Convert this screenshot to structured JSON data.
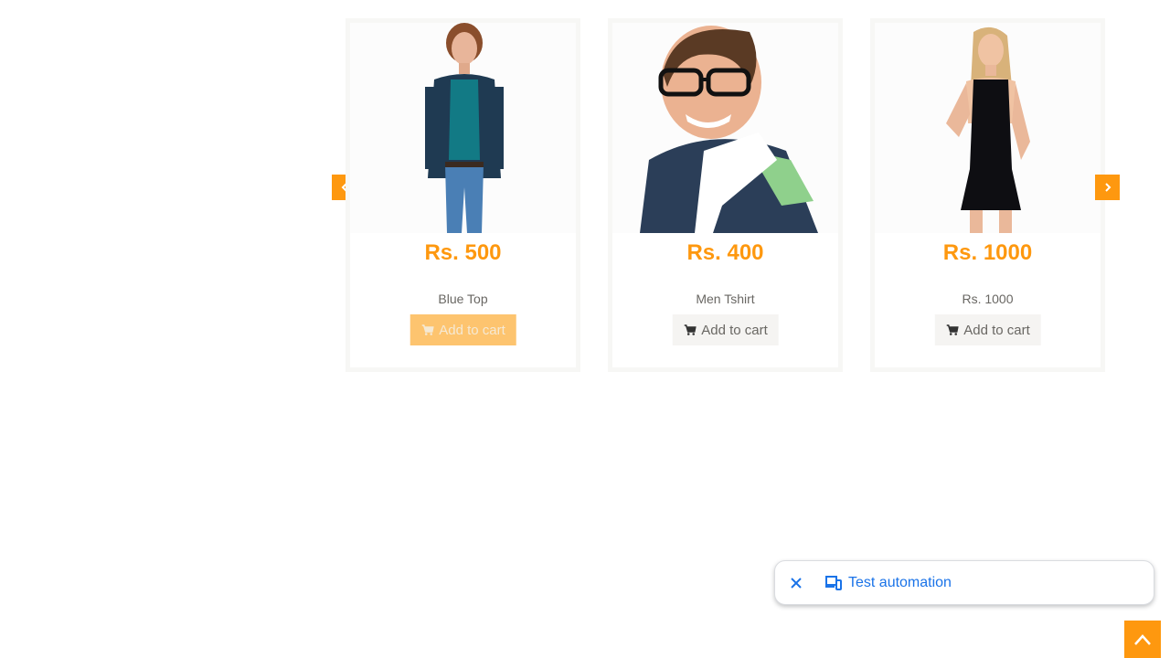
{
  "carousel": {
    "prev_icon": "chevron-left-icon",
    "next_icon": "chevron-right-icon",
    "products": [
      {
        "price": "Rs. 500",
        "name": "Blue Top",
        "button": "Add to cart",
        "image": "woman-blue-top"
      },
      {
        "price": "Rs. 400",
        "name": "Men Tshirt",
        "button": "Add to cart",
        "image": "man-tshirt"
      },
      {
        "price": "Rs. 1000",
        "name": "Rs. 1000",
        "button": "Add to cart",
        "image": "woman-black-dress"
      }
    ]
  },
  "toast": {
    "close_icon": "close-icon",
    "device_icon": "devices-icon",
    "label": "Test automation"
  },
  "scroll_up": {
    "icon": "chevron-up-icon"
  },
  "colors": {
    "accent": "#fe980f",
    "active_button": "#fdc46f",
    "button_bg": "#f5f4f2",
    "link_blue": "#1a73e8"
  }
}
